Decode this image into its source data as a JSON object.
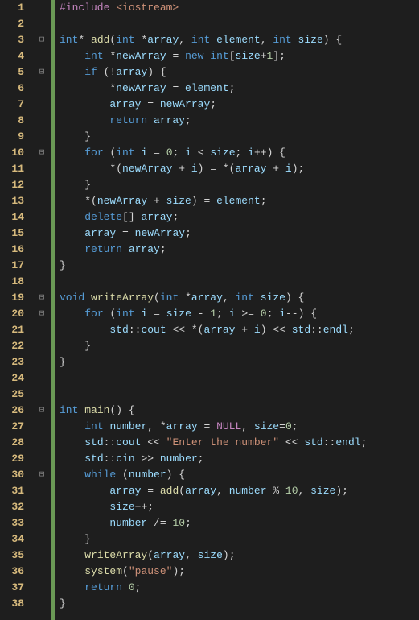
{
  "totalLines": 38,
  "folds": {
    "3": "⊟",
    "5": "⊟",
    "10": "⊟",
    "19": "⊟",
    "20": "⊟",
    "26": "⊟",
    "30": "⊟"
  },
  "code": [
    [
      [
        "preproc",
        "#include "
      ],
      [
        "incl",
        "<iostream>"
      ]
    ],
    [],
    [
      [
        "type",
        "int"
      ],
      [
        "op",
        "* "
      ],
      [
        "func",
        "add"
      ],
      [
        "op",
        "("
      ],
      [
        "type",
        "int "
      ],
      [
        "op",
        "*"
      ],
      [
        "ident",
        "array"
      ],
      [
        "op",
        ", "
      ],
      [
        "type",
        "int "
      ],
      [
        "ident",
        "element"
      ],
      [
        "op",
        ", "
      ],
      [
        "type",
        "int "
      ],
      [
        "ident",
        "size"
      ],
      [
        "op",
        ") {"
      ]
    ],
    [
      [
        "text",
        "    "
      ],
      [
        "type",
        "int "
      ],
      [
        "op",
        "*"
      ],
      [
        "ident",
        "newArray"
      ],
      [
        "op",
        " = "
      ],
      [
        "kw",
        "new "
      ],
      [
        "type",
        "int"
      ],
      [
        "op",
        "["
      ],
      [
        "ident",
        "size"
      ],
      [
        "op",
        "+"
      ],
      [
        "num",
        "1"
      ],
      [
        "op",
        "];"
      ]
    ],
    [
      [
        "text",
        "    "
      ],
      [
        "kw",
        "if "
      ],
      [
        "op",
        "(!"
      ],
      [
        "ident",
        "array"
      ],
      [
        "op",
        ") {"
      ]
    ],
    [
      [
        "text",
        "        *"
      ],
      [
        "ident",
        "newArray"
      ],
      [
        "op",
        " = "
      ],
      [
        "ident",
        "element"
      ],
      [
        "op",
        ";"
      ]
    ],
    [
      [
        "text",
        "        "
      ],
      [
        "ident",
        "array"
      ],
      [
        "op",
        " = "
      ],
      [
        "ident",
        "newArray"
      ],
      [
        "op",
        ";"
      ]
    ],
    [
      [
        "text",
        "        "
      ],
      [
        "kw",
        "return "
      ],
      [
        "ident",
        "array"
      ],
      [
        "op",
        ";"
      ]
    ],
    [
      [
        "text",
        "    }"
      ]
    ],
    [
      [
        "text",
        "    "
      ],
      [
        "kw",
        "for "
      ],
      [
        "op",
        "("
      ],
      [
        "type",
        "int "
      ],
      [
        "ident",
        "i"
      ],
      [
        "op",
        " = "
      ],
      [
        "num",
        "0"
      ],
      [
        "op",
        "; "
      ],
      [
        "ident",
        "i"
      ],
      [
        "op",
        " < "
      ],
      [
        "ident",
        "size"
      ],
      [
        "op",
        "; "
      ],
      [
        "ident",
        "i"
      ],
      [
        "op",
        "++) {"
      ]
    ],
    [
      [
        "text",
        "        *("
      ],
      [
        "ident",
        "newArray"
      ],
      [
        "op",
        " + "
      ],
      [
        "ident",
        "i"
      ],
      [
        "op",
        ") = *("
      ],
      [
        "ident",
        "array"
      ],
      [
        "op",
        " + "
      ],
      [
        "ident",
        "i"
      ],
      [
        "op",
        ");"
      ]
    ],
    [
      [
        "text",
        "    }"
      ]
    ],
    [
      [
        "text",
        "    *("
      ],
      [
        "ident",
        "newArray"
      ],
      [
        "op",
        " + "
      ],
      [
        "ident",
        "size"
      ],
      [
        "op",
        ") = "
      ],
      [
        "ident",
        "element"
      ],
      [
        "op",
        ";"
      ]
    ],
    [
      [
        "text",
        "    "
      ],
      [
        "kw",
        "delete"
      ],
      [
        "op",
        "[] "
      ],
      [
        "ident",
        "array"
      ],
      [
        "op",
        ";"
      ]
    ],
    [
      [
        "text",
        "    "
      ],
      [
        "ident",
        "array"
      ],
      [
        "op",
        " = "
      ],
      [
        "ident",
        "newArray"
      ],
      [
        "op",
        ";"
      ]
    ],
    [
      [
        "text",
        "    "
      ],
      [
        "kw",
        "return "
      ],
      [
        "ident",
        "array"
      ],
      [
        "op",
        ";"
      ]
    ],
    [
      [
        "text",
        "}"
      ]
    ],
    [],
    [
      [
        "type",
        "void "
      ],
      [
        "func",
        "writeArray"
      ],
      [
        "op",
        "("
      ],
      [
        "type",
        "int "
      ],
      [
        "op",
        "*"
      ],
      [
        "ident",
        "array"
      ],
      [
        "op",
        ", "
      ],
      [
        "type",
        "int "
      ],
      [
        "ident",
        "size"
      ],
      [
        "op",
        ") {"
      ]
    ],
    [
      [
        "text",
        "    "
      ],
      [
        "kw",
        "for "
      ],
      [
        "op",
        "("
      ],
      [
        "type",
        "int "
      ],
      [
        "ident",
        "i"
      ],
      [
        "op",
        " = "
      ],
      [
        "ident",
        "size"
      ],
      [
        "op",
        " - "
      ],
      [
        "num",
        "1"
      ],
      [
        "op",
        "; "
      ],
      [
        "ident",
        "i"
      ],
      [
        "op",
        " >= "
      ],
      [
        "num",
        "0"
      ],
      [
        "op",
        "; "
      ],
      [
        "ident",
        "i"
      ],
      [
        "op",
        "--) {"
      ]
    ],
    [
      [
        "text",
        "        "
      ],
      [
        "ident",
        "std"
      ],
      [
        "op",
        "::"
      ],
      [
        "ident",
        "cout"
      ],
      [
        "op",
        " << *("
      ],
      [
        "ident",
        "array"
      ],
      [
        "op",
        " + "
      ],
      [
        "ident",
        "i"
      ],
      [
        "op",
        ") << "
      ],
      [
        "ident",
        "std"
      ],
      [
        "op",
        "::"
      ],
      [
        "ident",
        "endl"
      ],
      [
        "op",
        ";"
      ]
    ],
    [
      [
        "text",
        "    }"
      ]
    ],
    [
      [
        "text",
        "}"
      ]
    ],
    [],
    [],
    [
      [
        "type",
        "int "
      ],
      [
        "func",
        "main"
      ],
      [
        "op",
        "() {"
      ]
    ],
    [
      [
        "text",
        "    "
      ],
      [
        "type",
        "int "
      ],
      [
        "ident",
        "number"
      ],
      [
        "op",
        ", *"
      ],
      [
        "ident",
        "array"
      ],
      [
        "op",
        " = "
      ],
      [
        "null",
        "NULL"
      ],
      [
        "op",
        ", "
      ],
      [
        "ident",
        "size"
      ],
      [
        "op",
        "="
      ],
      [
        "num",
        "0"
      ],
      [
        "op",
        ";"
      ]
    ],
    [
      [
        "text",
        "    "
      ],
      [
        "ident",
        "std"
      ],
      [
        "op",
        "::"
      ],
      [
        "ident",
        "cout"
      ],
      [
        "op",
        " << "
      ],
      [
        "str",
        "\"Enter the number\""
      ],
      [
        "op",
        " << "
      ],
      [
        "ident",
        "std"
      ],
      [
        "op",
        "::"
      ],
      [
        "ident",
        "endl"
      ],
      [
        "op",
        ";"
      ]
    ],
    [
      [
        "text",
        "    "
      ],
      [
        "ident",
        "std"
      ],
      [
        "op",
        "::"
      ],
      [
        "ident",
        "cin"
      ],
      [
        "op",
        " >> "
      ],
      [
        "ident",
        "number"
      ],
      [
        "op",
        ";"
      ]
    ],
    [
      [
        "text",
        "    "
      ],
      [
        "kw",
        "while "
      ],
      [
        "op",
        "("
      ],
      [
        "ident",
        "number"
      ],
      [
        "op",
        ") {"
      ]
    ],
    [
      [
        "text",
        "        "
      ],
      [
        "ident",
        "array"
      ],
      [
        "op",
        " = "
      ],
      [
        "func",
        "add"
      ],
      [
        "op",
        "("
      ],
      [
        "ident",
        "array"
      ],
      [
        "op",
        ", "
      ],
      [
        "ident",
        "number"
      ],
      [
        "op",
        " % "
      ],
      [
        "num",
        "10"
      ],
      [
        "op",
        ", "
      ],
      [
        "ident",
        "size"
      ],
      [
        "op",
        ");"
      ]
    ],
    [
      [
        "text",
        "        "
      ],
      [
        "ident",
        "size"
      ],
      [
        "op",
        "++;"
      ]
    ],
    [
      [
        "text",
        "        "
      ],
      [
        "ident",
        "number"
      ],
      [
        "op",
        " /= "
      ],
      [
        "num",
        "10"
      ],
      [
        "op",
        ";"
      ]
    ],
    [
      [
        "text",
        "    }"
      ]
    ],
    [
      [
        "text",
        "    "
      ],
      [
        "func",
        "writeArray"
      ],
      [
        "op",
        "("
      ],
      [
        "ident",
        "array"
      ],
      [
        "op",
        ", "
      ],
      [
        "ident",
        "size"
      ],
      [
        "op",
        ");"
      ]
    ],
    [
      [
        "text",
        "    "
      ],
      [
        "func",
        "system"
      ],
      [
        "op",
        "("
      ],
      [
        "str",
        "\"pause\""
      ],
      [
        "op",
        ");"
      ]
    ],
    [
      [
        "text",
        "    "
      ],
      [
        "kw",
        "return "
      ],
      [
        "num",
        "0"
      ],
      [
        "op",
        ";"
      ]
    ],
    [
      [
        "text",
        "}"
      ]
    ]
  ]
}
